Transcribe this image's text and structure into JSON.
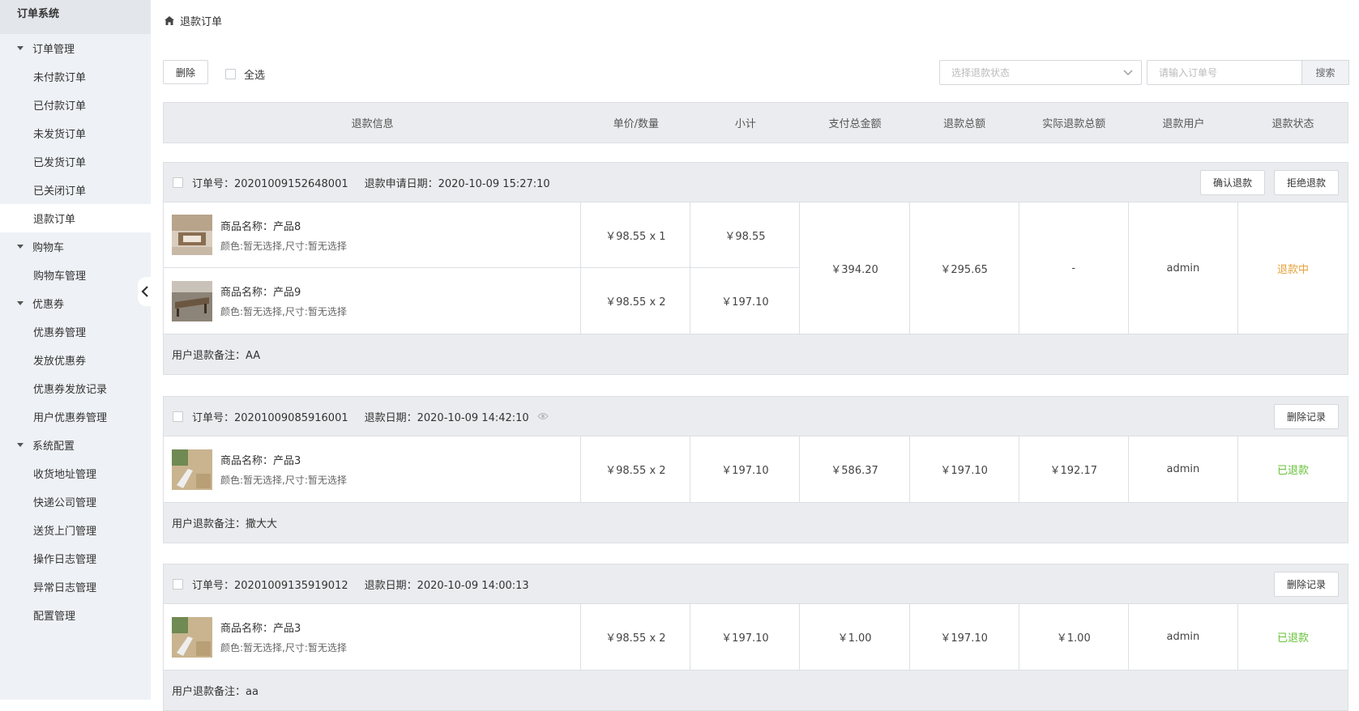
{
  "sidebar": {
    "brand": "订单系统",
    "groups": [
      {
        "label": "订单管理",
        "items": [
          "未付款订单",
          "已付款订单",
          "未发货订单",
          "已发货订单",
          "已关闭订单",
          "退款订单"
        ]
      },
      {
        "label": "购物车",
        "items": [
          "购物车管理"
        ]
      },
      {
        "label": "优惠券",
        "items": [
          "优惠券管理",
          "发放优惠券",
          "优惠券发放记录",
          "用户优惠券管理"
        ]
      },
      {
        "label": "系统配置",
        "items": [
          "收货地址管理",
          "快递公司管理",
          "送货上门管理",
          "操作日志管理",
          "异常日志管理",
          "配置管理"
        ]
      }
    ],
    "active_item": "退款订单"
  },
  "breadcrumb": {
    "label": "退款订单",
    "icon": "home-icon"
  },
  "toolbar": {
    "delete_label": "删除",
    "select_all_label": "全选",
    "status_placeholder": "选择退款状态",
    "search_placeholder": "请输入订单号",
    "search_label": "搜索"
  },
  "table_headers": [
    "退款信息",
    "单价/数量",
    "小计",
    "支付总金额",
    "退款总额",
    "实际退款总额",
    "退款用户",
    "退款状态"
  ],
  "colors": {
    "refunding": "#e6a23c",
    "refunded": "#67c23a",
    "sidebar_bg": "#eef1f5",
    "header_bg": "#eaecef"
  },
  "orders": [
    {
      "order_no": "订单号：20201009152648001",
      "date": "退款申请日期：2020-10-09 15:27:10",
      "actions": [
        "确认退款",
        "拒绝退款"
      ],
      "products": [
        {
          "name_prefix": "商品名称：",
          "name": "产品8",
          "spec": "颜色:暂无选择,尺寸:暂无选择",
          "price_qty": "￥98.55 x 1",
          "subtotal": "￥98.55"
        },
        {
          "name_prefix": "商品名称：",
          "name": "产品9",
          "spec": "颜色:暂无选择,尺寸:暂无选择",
          "price_qty": "￥98.55 x 2",
          "subtotal": "￥197.10"
        }
      ],
      "paid_total": "￥394.20",
      "refund_total": "￥295.65",
      "actual_refund": "-",
      "user": "admin",
      "status": "退款中",
      "note": "用户退款备注：AA"
    },
    {
      "order_no": "订单号：20201009085916001",
      "date": "退款日期：2020-10-09 14:42:10",
      "actions": [
        "删除记录"
      ],
      "products": [
        {
          "name_prefix": "商品名称：",
          "name": "产品3",
          "spec": "颜色:暂无选择,尺寸:暂无选择",
          "price_qty": "￥98.55 x 2",
          "subtotal": "￥197.10"
        }
      ],
      "paid_total": "￥586.37",
      "refund_total": "￥197.10",
      "actual_refund": "￥192.17",
      "user": "admin",
      "status": "已退款",
      "note": "用户退款备注：撒大大"
    },
    {
      "order_no": "订单号：20201009135919012",
      "date": "退款日期：2020-10-09 14:00:13",
      "actions": [
        "删除记录"
      ],
      "products": [
        {
          "name_prefix": "商品名称：",
          "name": "产品3",
          "spec": "颜色:暂无选择,尺寸:暂无选择",
          "price_qty": "￥98.55 x 2",
          "subtotal": "￥197.10"
        }
      ],
      "paid_total": "￥1.00",
      "refund_total": "￥197.10",
      "actual_refund": "￥1.00",
      "user": "admin",
      "status": "已退款",
      "note": "用户退款备注：aa"
    }
  ]
}
